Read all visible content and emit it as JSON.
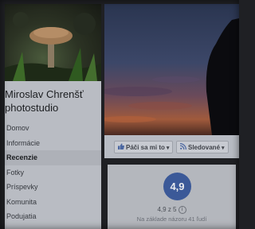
{
  "page": {
    "name_line1": "Miroslav Chrenšť",
    "name_line2": "photostudio"
  },
  "nav": {
    "items": [
      "Domov",
      "Informácie",
      "Recenzie",
      "Fotky",
      "Príspevky",
      "Komunita",
      "Podujatia"
    ],
    "active": "Recenzie"
  },
  "toolbar": {
    "like_label": "Páči sa mi to",
    "follow_label": "Sledované"
  },
  "rating": {
    "score": "4,9",
    "out_of": "4,9 z 5",
    "based_on": "Na základe názoru 41 ľudí"
  },
  "colors": {
    "accent": "#3b5998"
  }
}
